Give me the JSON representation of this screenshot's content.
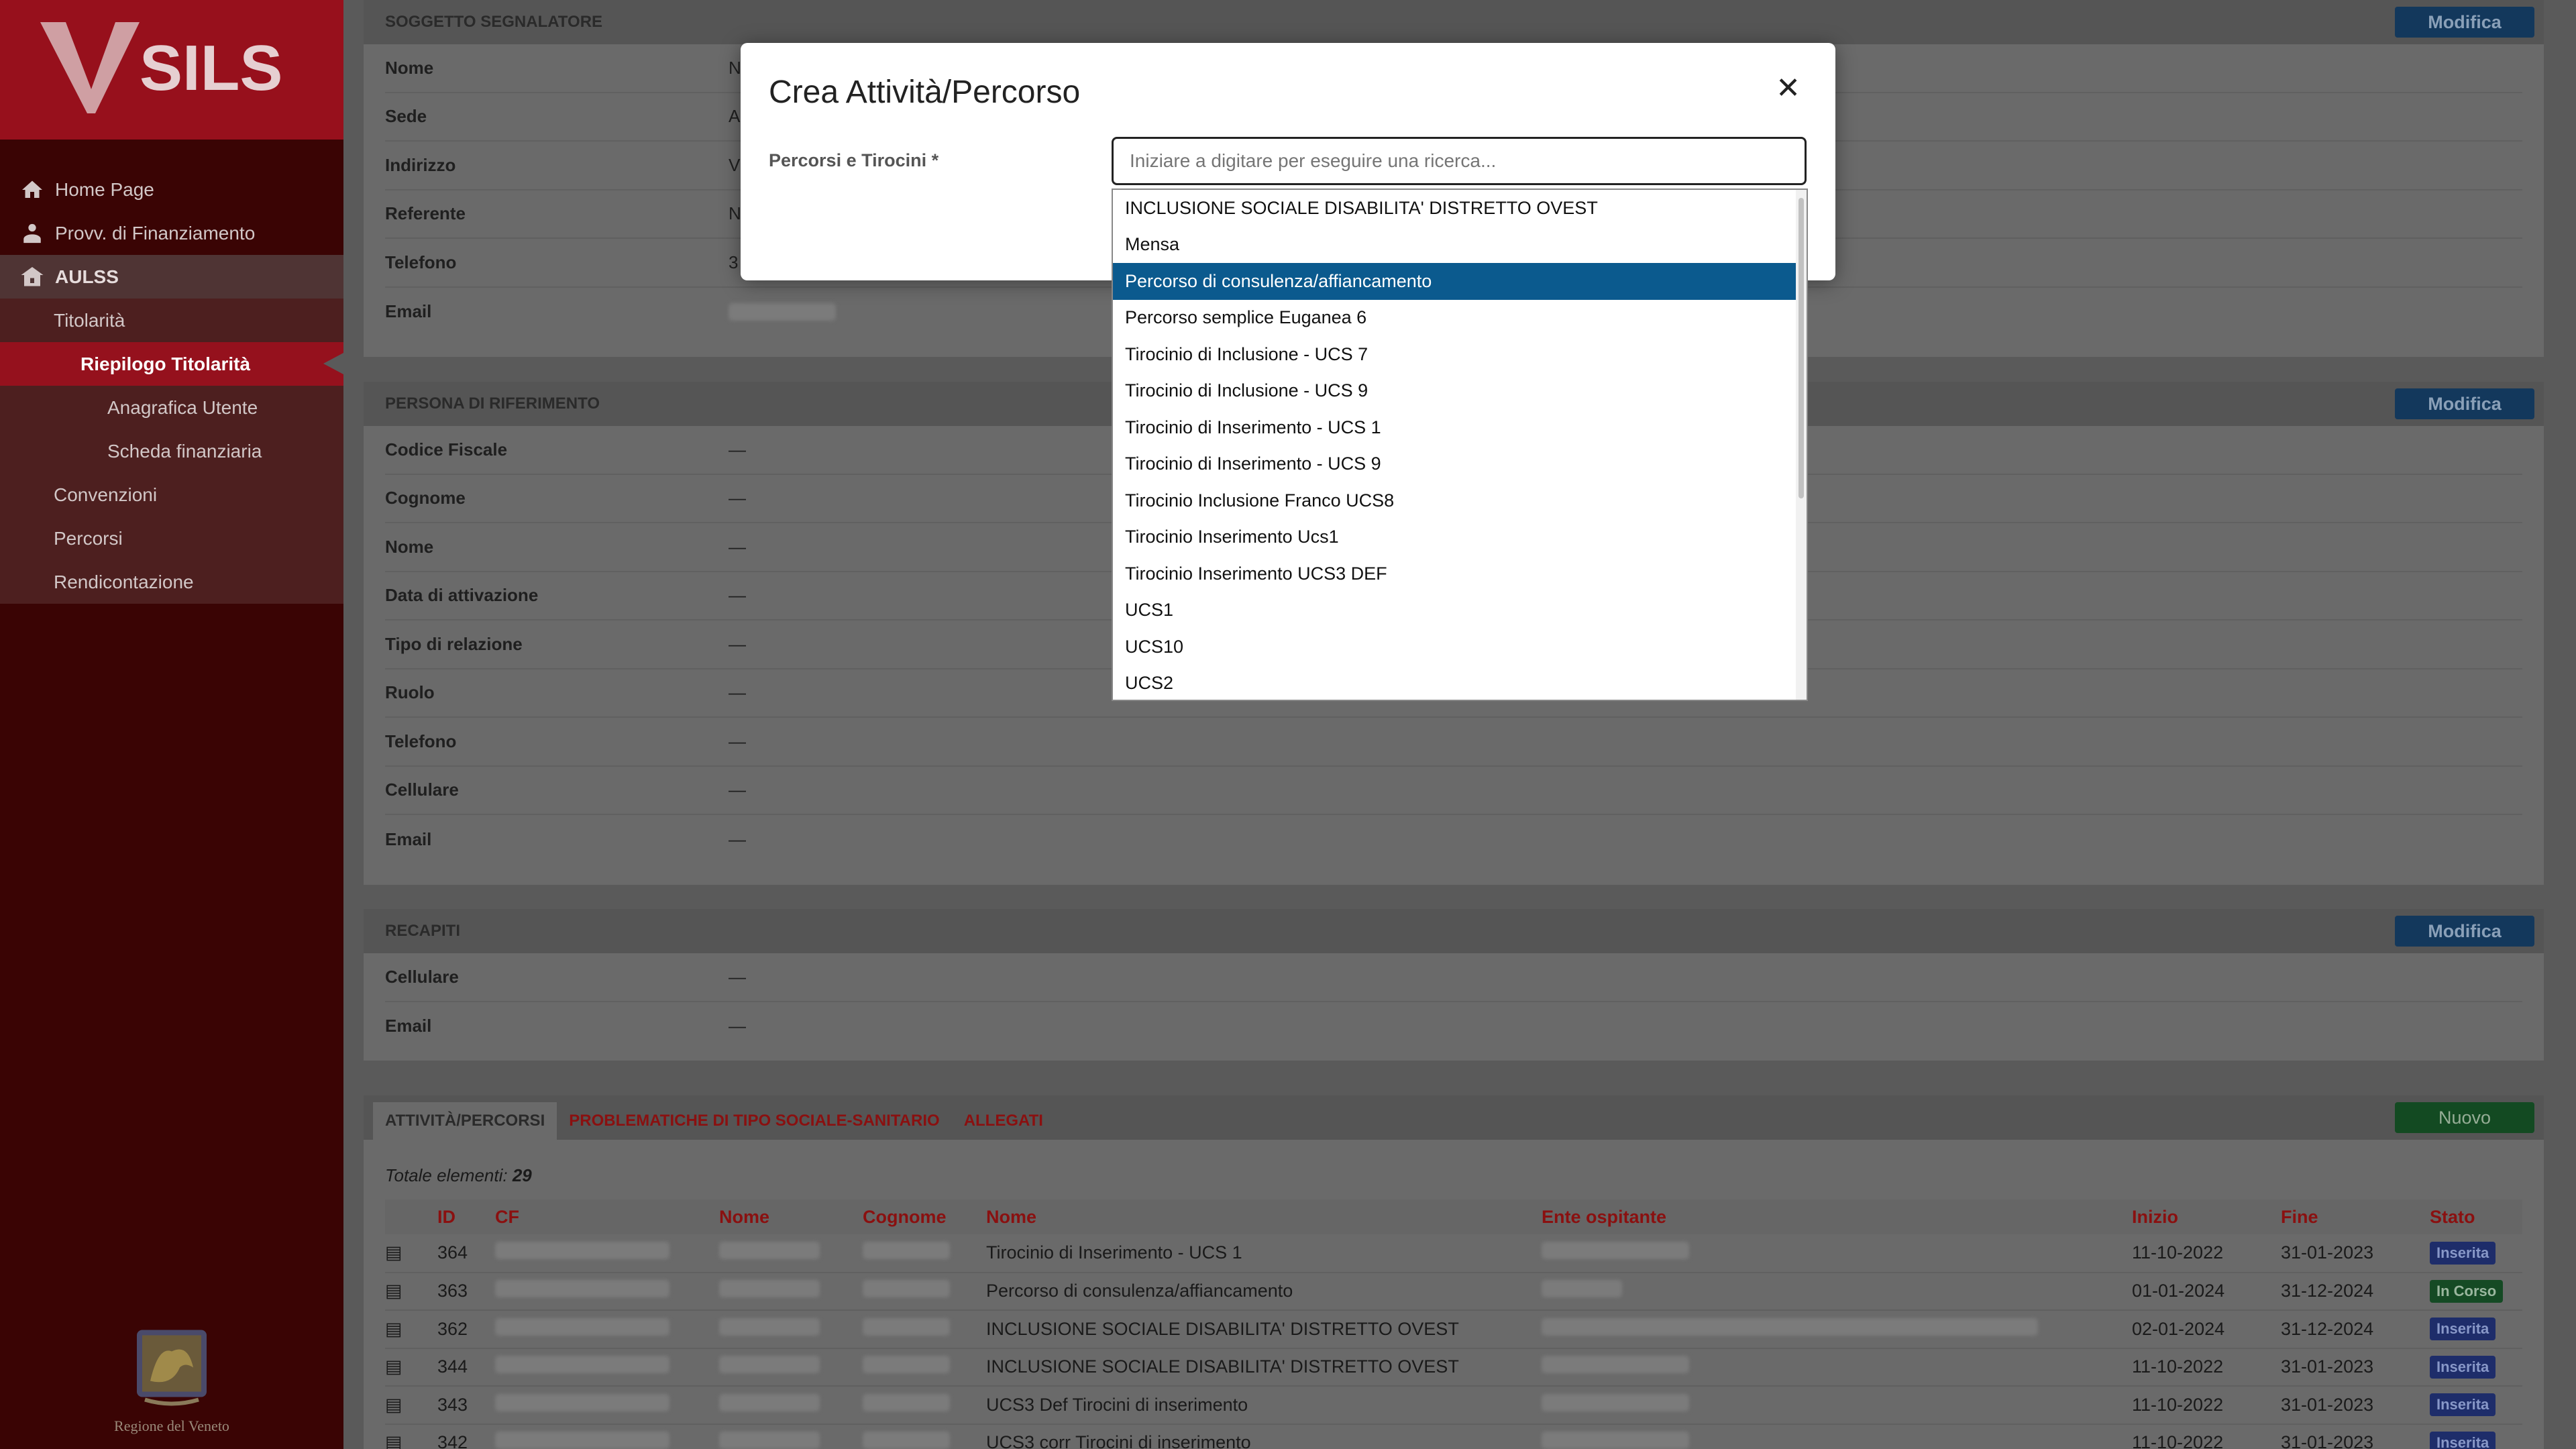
{
  "sidebar": {
    "logo_text": "SILS",
    "items": [
      {
        "label": "Home Page",
        "icon": "home-icon"
      },
      {
        "label": "Provv. di Finanziamento",
        "icon": "user-icon"
      },
      {
        "label": "AULSS",
        "icon": "building-icon"
      },
      {
        "label": "Titolarità"
      },
      {
        "label": "Riepilogo Titolarità"
      },
      {
        "label": "Anagrafica Utente"
      },
      {
        "label": "Scheda finanziaria"
      },
      {
        "label": "Convenzioni"
      },
      {
        "label": "Percorsi"
      },
      {
        "label": "Rendicontazione"
      }
    ],
    "footer": "Regione del Veneto"
  },
  "soggetto": {
    "title": "SOGGETTO SEGNALATORE",
    "button": "Modifica",
    "rows": [
      {
        "label": "Nome",
        "value": "N"
      },
      {
        "label": "Sede",
        "value": "A"
      },
      {
        "label": "Indirizzo",
        "value": "V"
      },
      {
        "label": "Referente",
        "value": "N"
      },
      {
        "label": "Telefono",
        "value": "3"
      },
      {
        "label": "Email",
        "value": ""
      }
    ]
  },
  "persona": {
    "title": "PERSONA DI RIFERIMENTO",
    "button": "Modifica",
    "rows": [
      {
        "label": "Codice Fiscale",
        "value": "—"
      },
      {
        "label": "Cognome",
        "value": "—"
      },
      {
        "label": "Nome",
        "value": "—"
      },
      {
        "label": "Data di attivazione",
        "value": "—"
      },
      {
        "label": "Tipo di relazione",
        "value": "—"
      },
      {
        "label": "Ruolo",
        "value": "—"
      },
      {
        "label": "Telefono",
        "value": "—"
      },
      {
        "label": "Cellulare",
        "value": "—"
      },
      {
        "label": "Email",
        "value": "—"
      }
    ]
  },
  "recapiti": {
    "title": "RECAPITI",
    "button": "Modifica",
    "rows": [
      {
        "label": "Cellulare",
        "value": "—"
      },
      {
        "label": "Email",
        "value": "—"
      }
    ]
  },
  "attivita": {
    "tabs": [
      "ATTIVITÀ/PERCORSI",
      "PROBLEMATICHE DI TIPO SOCIALE-SANITARIO",
      "ALLEGATI"
    ],
    "new_button": "Nuovo",
    "total_label": "Totale elementi:",
    "total": "29",
    "columns": [
      "ID",
      "CF",
      "Nome",
      "Cognome",
      "Nome",
      "Ente ospitante",
      "Inizio",
      "Fine",
      "Stato"
    ],
    "rows": [
      {
        "id": "364",
        "nome": "Tirocinio di Inserimento - UCS 1",
        "inizio": "11-10-2022",
        "fine": "31-01-2023",
        "stato": "Inserita"
      },
      {
        "id": "363",
        "nome": "Percorso di consulenza/affiancamento",
        "inizio": "01-01-2024",
        "fine": "31-12-2024",
        "stato": "In Corso"
      },
      {
        "id": "362",
        "nome": "INCLUSIONE SOCIALE DISABILITA' DISTRETTO OVEST",
        "inizio": "02-01-2024",
        "fine": "31-12-2024",
        "stato": "Inserita"
      },
      {
        "id": "344",
        "nome": "INCLUSIONE SOCIALE DISABILITA' DISTRETTO OVEST",
        "inizio": "11-10-2022",
        "fine": "31-01-2023",
        "stato": "Inserita"
      },
      {
        "id": "343",
        "nome": "UCS3 Def Tirocini di inserimento",
        "inizio": "11-10-2022",
        "fine": "31-01-2023",
        "stato": "Inserita"
      },
      {
        "id": "342",
        "nome": "UCS3 corr Tirocini di inserimento",
        "inizio": "11-10-2022",
        "fine": "31-01-2023",
        "stato": "Inserita"
      }
    ]
  },
  "modal": {
    "title": "Crea Attività/Percorso",
    "field_label": "Percorsi e Tirocini *",
    "placeholder": "Iniziare a digitare per eseguire una ricerca...",
    "options": [
      "INCLUSIONE SOCIALE DISABILITA' DISTRETTO OVEST",
      "Mensa",
      "Percorso di consulenza/affiancamento",
      "Percorso semplice Euganea 6",
      "Tirocinio di Inclusione - UCS 7",
      "Tirocinio di Inclusione - UCS 9",
      "Tirocinio di Inserimento - UCS 1",
      "Tirocinio di Inserimento - UCS 9",
      "Tirocinio Inclusione Franco UCS8",
      "Tirocinio Inserimento Ucs1",
      "Tirocinio Inserimento UCS3 DEF",
      "UCS1",
      "UCS10",
      "UCS2"
    ],
    "selected_index": 2
  },
  "colors": {
    "brand": "#97101c",
    "selected": "#0b5a8e",
    "primary_btn": "#1a4f80",
    "success": "#1a7a38"
  }
}
